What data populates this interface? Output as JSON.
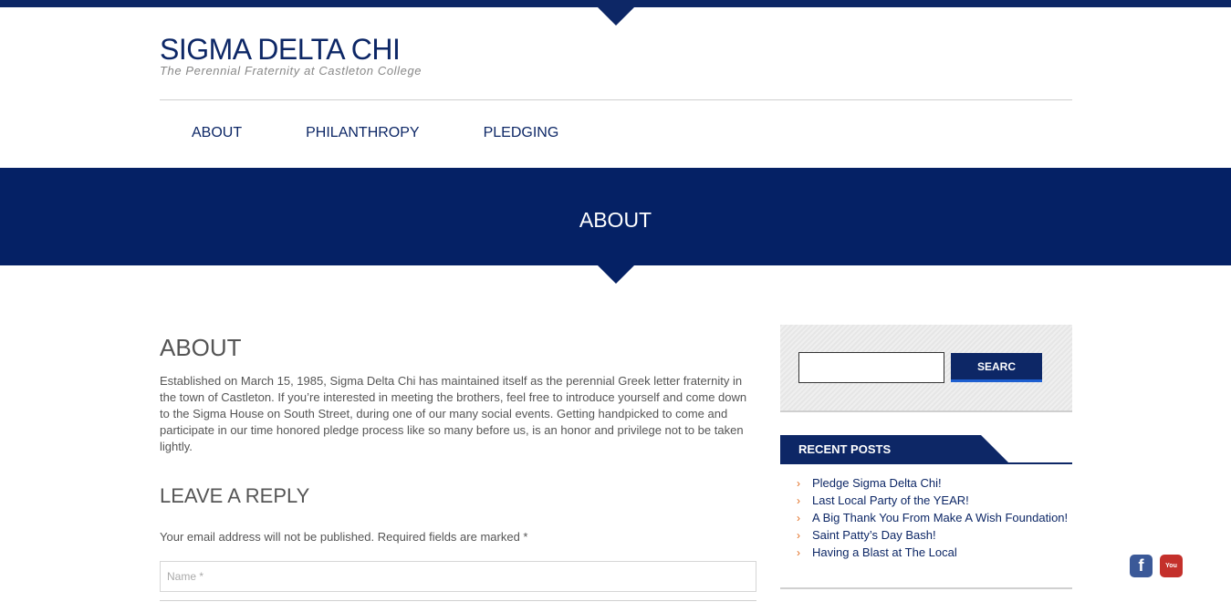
{
  "site": {
    "title": "SIGMA DELTA CHI",
    "tagline": "The Perennial Fraternity at Castleton College"
  },
  "nav": {
    "items": [
      {
        "label": "ABOUT"
      },
      {
        "label": "PHILANTHROPY"
      },
      {
        "label": "PLEDGING"
      }
    ]
  },
  "banner": {
    "title": "ABOUT"
  },
  "post": {
    "title": "ABOUT",
    "body": "Established on March 15, 1985, Sigma Delta Chi has maintained itself as the perennial Greek letter fraternity in the town of Castleton. If you’re interested in meeting the brothers, feel free to introduce yourself and come down to the Sigma House on South Street, during one of our many social events. Getting handpicked to come and participate in our time honored pledge process like so many before us, is an honor and privilege not to be taken lightly."
  },
  "reply": {
    "title": "LEAVE A REPLY",
    "note": "Your email address will not be published. Required fields are marked *",
    "name_placeholder": "Name *"
  },
  "sidebar": {
    "search": {
      "button_label": "SEARC",
      "value": ""
    },
    "recent_posts": {
      "title": "RECENT POSTS",
      "items": [
        {
          "label": "Pledge Sigma Delta Chi!"
        },
        {
          "label": "Last Local Party of the YEAR!"
        },
        {
          "label": "A Big Thank You From Make A Wish Foundation!"
        },
        {
          "label": "Saint Patty’s Day Bash!"
        },
        {
          "label": "Having a Blast at The Local"
        }
      ]
    }
  },
  "social": {
    "facebook_icon": "f",
    "youtube_icon": "You Tube"
  },
  "colors": {
    "brand": "#0d2766",
    "accent": "#e06a1b"
  }
}
